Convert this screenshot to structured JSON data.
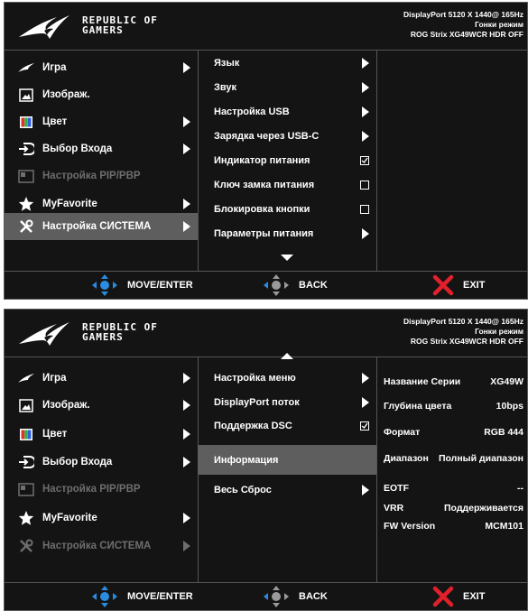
{
  "brand": {
    "line1": "REPUBLIC OF",
    "line2": "GAMERS"
  },
  "panel1": {
    "info": [
      "DisplayPort 5120 X 1440@ 165Hz",
      "Гонки режим",
      "ROG Strix XG49WCR HDR OFF"
    ],
    "main_menu": [
      "Игра",
      "Изображ.",
      "Цвет",
      "Выбор Входа",
      "Настройка PIP/PBP",
      "MyFavorite",
      "Настройка СИСТЕМА"
    ],
    "sub_menu": [
      "Язык",
      "Звук",
      "Настройка USB",
      "Зарядка через USB-C",
      "Индикатор питания",
      "Ключ замка питания",
      "Блокировка кнопки",
      "Параметры питания"
    ]
  },
  "panel2": {
    "info": [
      "DisplayPort 5120 X 1440@ 165Hz",
      "Гонки режим",
      "ROG Strix XG49WCR HDR OFF"
    ],
    "main_menu": [
      "Игра",
      "Изображ.",
      "Цвет",
      "Выбор Входа",
      "Настройка PIP/PBP",
      "MyFavorite",
      "Настройка СИСТЕМА"
    ],
    "sub_menu": [
      "Настройка меню",
      "DisplayPort поток",
      "Поддержка DSC",
      "Информация",
      "Весь Сброс"
    ],
    "info_rows": [
      {
        "k": "Название Серии",
        "v": "XG49W"
      },
      {
        "k": "Глубина цвета",
        "v": "10bps"
      },
      {
        "k": "Формат",
        "v": "RGB 444"
      },
      {
        "k": "Диапазон",
        "v": "Полный диапазон"
      },
      {
        "k": "EOTF",
        "v": "--"
      },
      {
        "k": "VRR",
        "v": "Поддерживается"
      },
      {
        "k": "FW Version",
        "v": "MCM101"
      }
    ]
  },
  "footer": {
    "move": "MOVE/ENTER",
    "back": "BACK",
    "exit": "EXIT"
  },
  "colors": {
    "selected": "#5e5e5e",
    "exit_red": "#e0202a",
    "nav_blue": "#2a8be0",
    "dim": "#6e6e6e"
  }
}
